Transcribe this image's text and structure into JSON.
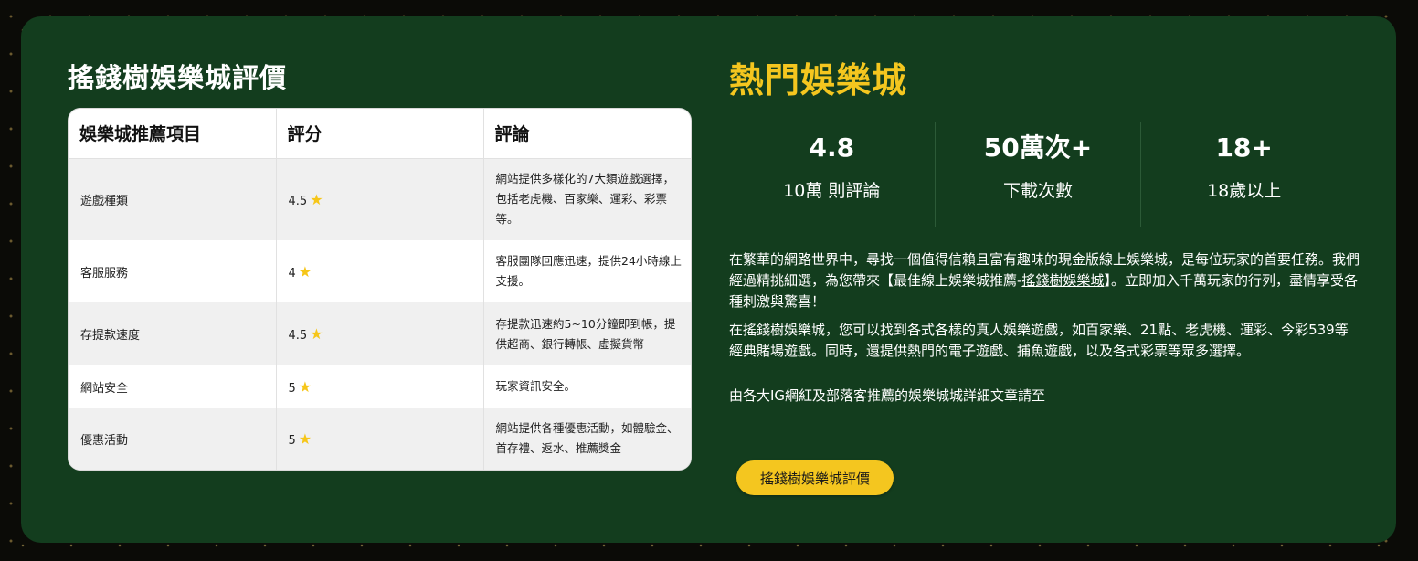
{
  "review": {
    "title": "搖錢樹娛樂城評價",
    "headers": [
      "娛樂城推薦項目",
      "評分",
      "評論"
    ],
    "rows": [
      {
        "item": "遊戲種類",
        "score": "4.5",
        "comment": "網站提供多樣化的7大類遊戲選擇，包括老虎機、百家樂、運彩、彩票等。"
      },
      {
        "item": "客服服務",
        "score": "4",
        "comment": "客服團隊回應迅速，提供24小時線上支援。"
      },
      {
        "item": "存提款速度",
        "score": "4.5",
        "comment": "存提款迅速約5~10分鐘即到帳，提供超商、銀行轉帳、虛擬貨幣"
      },
      {
        "item": "網站安全",
        "score": "5",
        "comment": "玩家資訊安全。"
      },
      {
        "item": "優惠活動",
        "score": "5",
        "comment": "網站提供各種優惠活動，如體驗金、首存禮、返水、推薦獎金"
      }
    ],
    "star_icon": "star-icon",
    "star_color": "#f6c619"
  },
  "hot": {
    "title": "熱門娛樂城",
    "stats": [
      {
        "value": "4.8",
        "label": "10萬 則評論"
      },
      {
        "value": "50萬次+",
        "label": "下載次數"
      },
      {
        "value": "18+",
        "label": "18歲以上"
      }
    ],
    "para1_before": "在繁華的網路世界中，尋找一個值得信賴且富有趣味的現金版線上娛樂城，是每位玩家的首要任務。我們經過精挑細選，為您帶來【最佳線上娛樂城推薦-",
    "para1_link": "搖錢樹娛樂城",
    "para1_after": "】。立即加入千萬玩家的行列，盡情享受各種刺激與驚喜！",
    "para2": "在搖錢樹娛樂城，您可以找到各式各樣的真人娛樂遊戲，如百家樂、21點、老虎機、運彩、今彩539等經典賭場遊戲。同時，還提供熱門的電子遊戲、捕魚遊戲，以及各式彩票等眾多選擇。",
    "para3": "由各大IG網紅及部落客推薦的娛樂城城詳細文章請至",
    "button_label": "搖錢樹娛樂城評價"
  },
  "colors": {
    "panel": "#133d1e",
    "accent": "#f4c61f",
    "background": "#0b0b07"
  }
}
